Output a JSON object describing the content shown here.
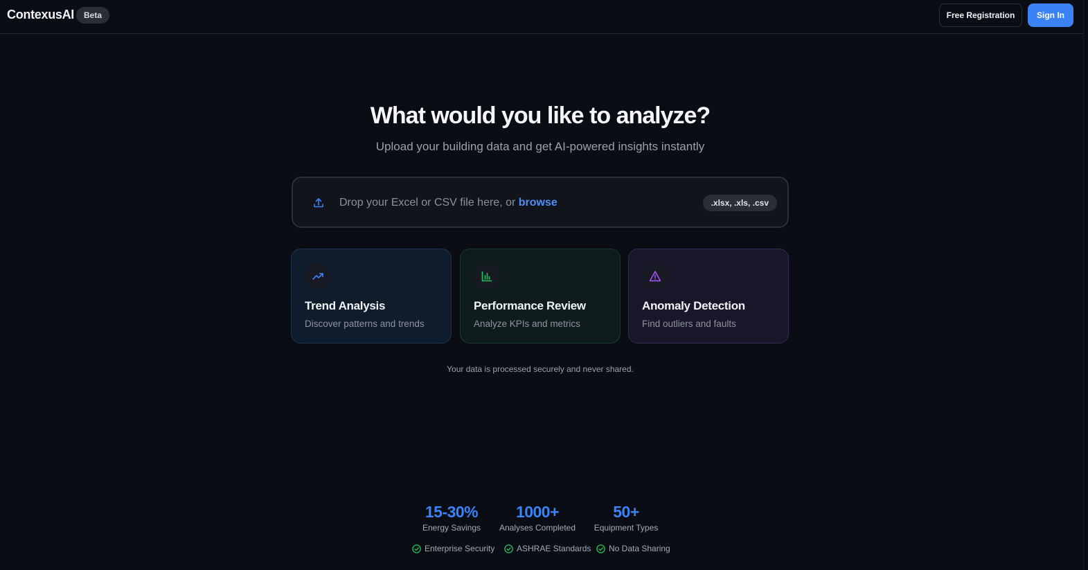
{
  "header": {
    "brand": "ContexusAI",
    "badge": "Beta",
    "register_label": "Free Registration",
    "signin_label": "Sign In"
  },
  "hero": {
    "title": "What would you like to analyze?",
    "subtitle": "Upload your building data and get AI-powered insights instantly"
  },
  "upload": {
    "icon": "upload-icon",
    "prompt": "Drop your Excel or CSV file here, or ",
    "browse_label": "browse",
    "formats": ".xlsx, .xls, .csv"
  },
  "cards": [
    {
      "icon": "trending-up-icon",
      "title": "Trend Analysis",
      "description": "Discover patterns and trends",
      "accent": "#3b82f6"
    },
    {
      "icon": "bar-chart-icon",
      "title": "Performance Review",
      "description": "Analyze KPIs and metrics",
      "accent": "#22c55e"
    },
    {
      "icon": "alert-triangle-icon",
      "title": "Anomaly Detection",
      "description": "Find outliers and faults",
      "accent": "#a855f7"
    }
  ],
  "secure_note": "Your data is processed securely and never shared.",
  "stats": [
    {
      "value": "15-30%",
      "label": "Energy Savings"
    },
    {
      "value": "1000+",
      "label": "Analyses Completed"
    },
    {
      "value": "50+",
      "label": "Equipment Types"
    }
  ],
  "trust_badges": [
    {
      "icon": "check-circle-icon",
      "label": "Enterprise Security"
    },
    {
      "icon": "check-circle-icon",
      "label": "ASHRAE Standards"
    },
    {
      "icon": "check-circle-icon",
      "label": "No Data Sharing"
    }
  ],
  "colors": {
    "background": "#0b0d14",
    "primary": "#3b82f6",
    "success": "#22c55e",
    "purple": "#a855f7"
  }
}
